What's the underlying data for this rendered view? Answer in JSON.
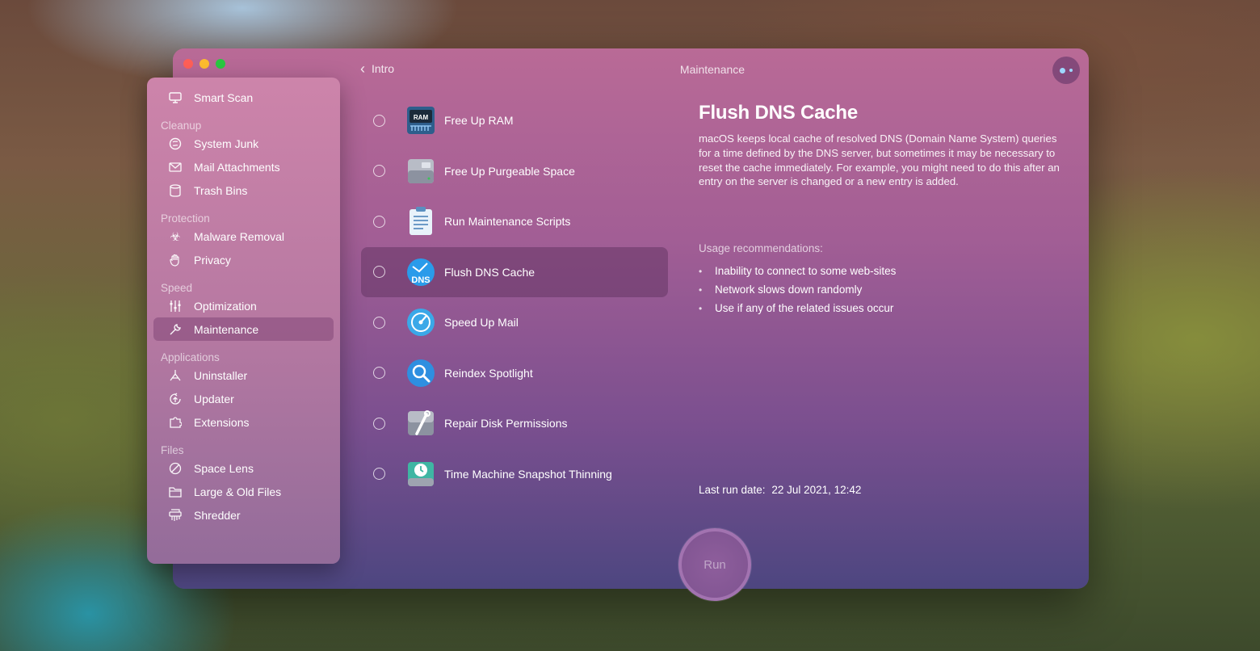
{
  "window": {
    "title": "Maintenance",
    "back_label": "Intro"
  },
  "sidebar": {
    "top_item": {
      "label": "Smart Scan",
      "icon": "monitor-icon"
    },
    "sections": [
      {
        "header": "Cleanup",
        "items": [
          {
            "label": "System Junk",
            "icon": "junk-icon"
          },
          {
            "label": "Mail Attachments",
            "icon": "mail-icon"
          },
          {
            "label": "Trash Bins",
            "icon": "trash-icon"
          }
        ]
      },
      {
        "header": "Protection",
        "items": [
          {
            "label": "Malware Removal",
            "icon": "biohazard-icon"
          },
          {
            "label": "Privacy",
            "icon": "hand-icon"
          }
        ]
      },
      {
        "header": "Speed",
        "items": [
          {
            "label": "Optimization",
            "icon": "sliders-icon"
          },
          {
            "label": "Maintenance",
            "icon": "wrench-icon",
            "active": true
          }
        ]
      },
      {
        "header": "Applications",
        "items": [
          {
            "label": "Uninstaller",
            "icon": "uninstaller-icon"
          },
          {
            "label": "Updater",
            "icon": "updater-icon"
          },
          {
            "label": "Extensions",
            "icon": "extensions-icon"
          }
        ]
      },
      {
        "header": "Files",
        "items": [
          {
            "label": "Space Lens",
            "icon": "lens-icon"
          },
          {
            "label": "Large & Old Files",
            "icon": "folder-icon"
          },
          {
            "label": "Shredder",
            "icon": "shredder-icon"
          }
        ]
      }
    ]
  },
  "tasks": [
    {
      "label": "Free Up RAM",
      "icon": "ram-icon",
      "icon_text": "RAM",
      "selected": false
    },
    {
      "label": "Free Up Purgeable Space",
      "icon": "disk-icon",
      "selected": false
    },
    {
      "label": "Run Maintenance Scripts",
      "icon": "clipboard-icon",
      "selected": false
    },
    {
      "label": "Flush DNS Cache",
      "icon": "dns-icon",
      "icon_text": "DNS",
      "selected": false,
      "active": true
    },
    {
      "label": "Speed Up Mail",
      "icon": "speed-mail-icon",
      "selected": false
    },
    {
      "label": "Reindex Spotlight",
      "icon": "spotlight-icon",
      "selected": false
    },
    {
      "label": "Repair Disk Permissions",
      "icon": "disk-repair-icon",
      "selected": false
    },
    {
      "label": "Time Machine Snapshot Thinning",
      "icon": "time-machine-icon",
      "selected": false
    }
  ],
  "detail": {
    "title": "Flush DNS Cache",
    "description": "macOS keeps local cache of resolved DNS (Domain Name System) queries for a time defined by the DNS server, but sometimes it may be necessary to reset the cache immediately. For example, you might need to do this after an entry on the server is changed or a new entry is added.",
    "usage_header": "Usage recommendations:",
    "usage": [
      "Inability to connect to some web-sites",
      "Network slows down randomly",
      "Use if any of the related issues occur"
    ],
    "last_run_label": "Last run date:",
    "last_run_value": "22 Jul 2021, 12:42"
  },
  "run_button": {
    "label": "Run"
  },
  "colors": {
    "window_top": "#b96a96",
    "window_bottom": "#4d4680",
    "active_row": "#6e3f6e"
  }
}
